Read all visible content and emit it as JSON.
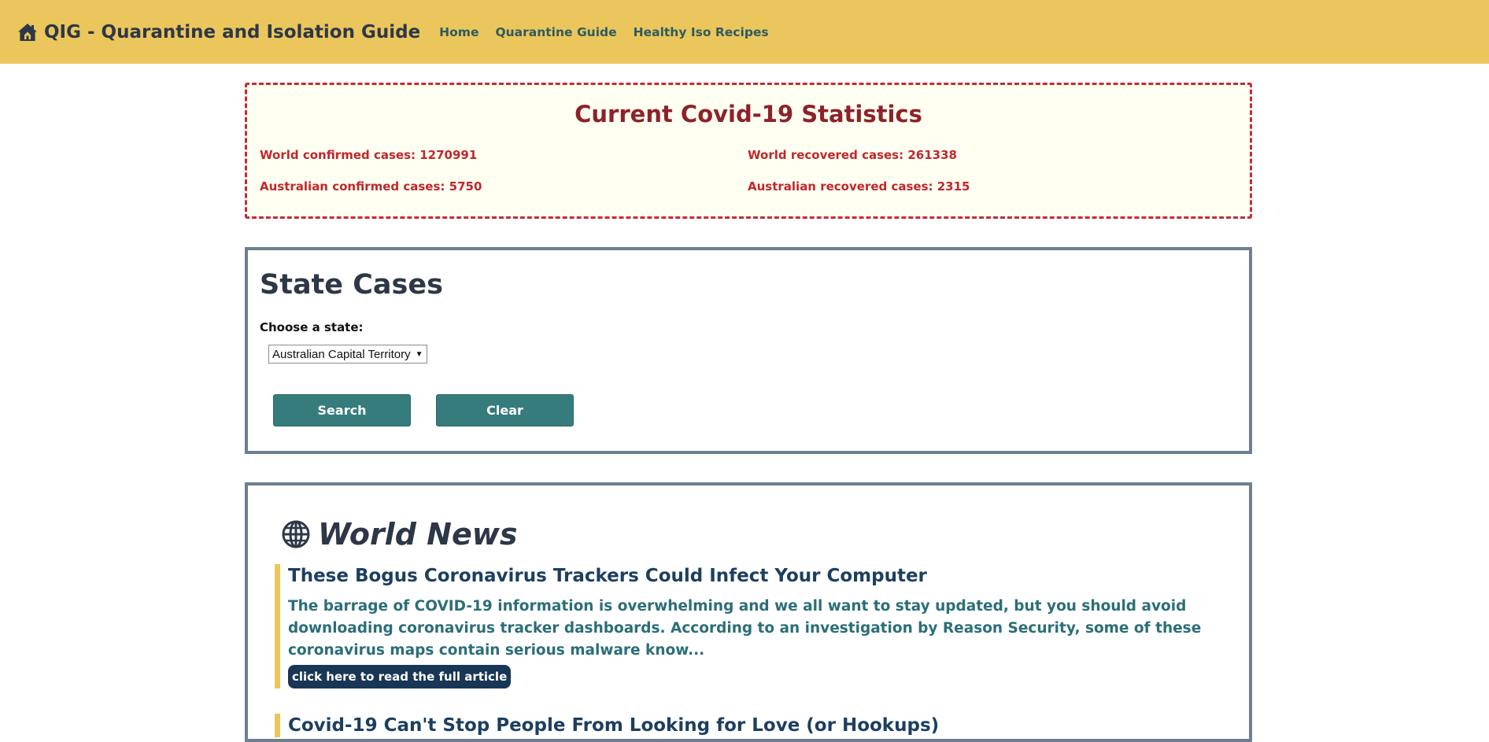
{
  "nav": {
    "brand": "QIG - Quarantine and Isolation Guide",
    "brand_icon": "home-icon",
    "links": [
      "Home",
      "Quarantine Guide",
      "Healthy Iso Recipes"
    ]
  },
  "stats": {
    "title": "Current Covid-19 Statistics",
    "world_confirmed": "World confirmed cases: 1270991",
    "world_recovered": "World recovered cases: 261338",
    "aus_confirmed": "Australian confirmed cases: 5750",
    "aus_recovered": "Australian recovered cases: 2315"
  },
  "state": {
    "title": "State Cases",
    "label": "Choose a state:",
    "selected": "Australian Capital Territory",
    "search_label": "Search",
    "clear_label": "Clear"
  },
  "news": {
    "heading": "World News",
    "heading_icon": "globe-icon",
    "articles": [
      {
        "title": "These Bogus Coronavirus Trackers Could Infect Your Computer",
        "desc": "The barrage of COVID-19 information is overwhelming and we all want to stay updated, but you should avoid downloading coronavirus tracker dashboards. According to an investigation by Reason Security, some of these coronavirus maps contain serious malware know...",
        "link": "click here to read the full article"
      },
      {
        "title": "Covid-19 Can't Stop People From Looking for Love (or Hookups)"
      }
    ]
  },
  "colors": {
    "navbar": "#ebc65c",
    "stats_border": "#c62a37",
    "panel_border": "#6d7f91",
    "button": "#367c7c",
    "link_button": "#193655"
  }
}
